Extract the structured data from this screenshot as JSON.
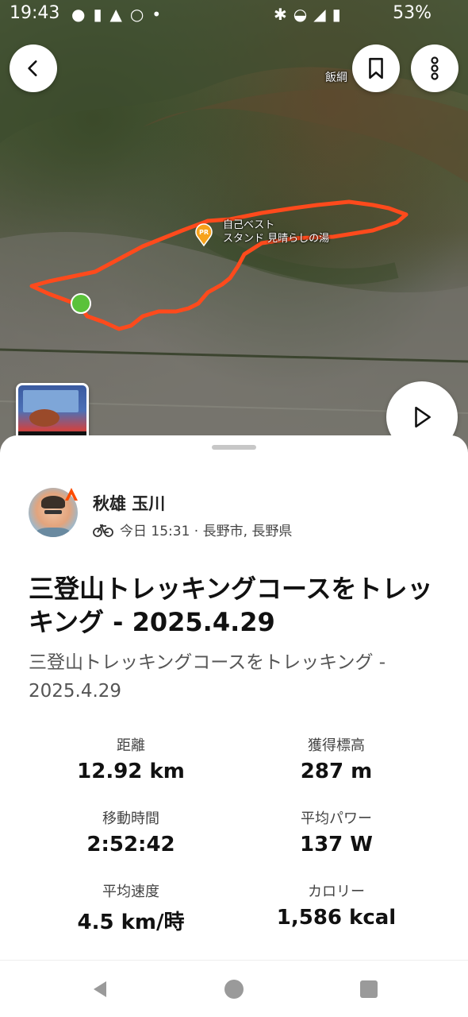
{
  "status_bar": {
    "time": "19:43",
    "battery": "53%"
  },
  "map": {
    "labels": {
      "poi_line1": "自己ベスト",
      "poi_line2": "スタンド 見晴らしの湯",
      "place": "飯綱"
    },
    "route_color": "#ff4a1c",
    "start_marker_color": "#5ac23a",
    "poi_badge": "PR"
  },
  "activity": {
    "user": "秋雄 玉川",
    "meta": "今日 15:31 · 長野市, 長野県",
    "title": "三登山トレッキングコースをトレッキング - 2025.4.29",
    "description": "三登山トレッキングコースをトレッキング - 2025.4.29"
  },
  "stats": [
    {
      "label": "距離",
      "value": "12.92 km"
    },
    {
      "label": "獲得標高",
      "value": "287 m"
    },
    {
      "label": "移動時間",
      "value": "2:52:42"
    },
    {
      "label": "平均パワー",
      "value": "137 W"
    },
    {
      "label": "平均速度",
      "value": "4.5 km/時"
    },
    {
      "label": "カロリー",
      "value": "1,586 kcal"
    }
  ],
  "colors": {
    "accent": "#fc4c02",
    "text_primary": "#111111",
    "text_secondary": "#555555"
  },
  "icons": {
    "back": "chevron-left-icon",
    "bookmark": "bookmark-icon",
    "more": "more-vertical-icon",
    "play": "play-icon",
    "activity_type": "bicycle-icon",
    "nav_back": "triangle-back-icon",
    "nav_home": "circle-home-icon",
    "nav_recents": "square-recents-icon"
  }
}
